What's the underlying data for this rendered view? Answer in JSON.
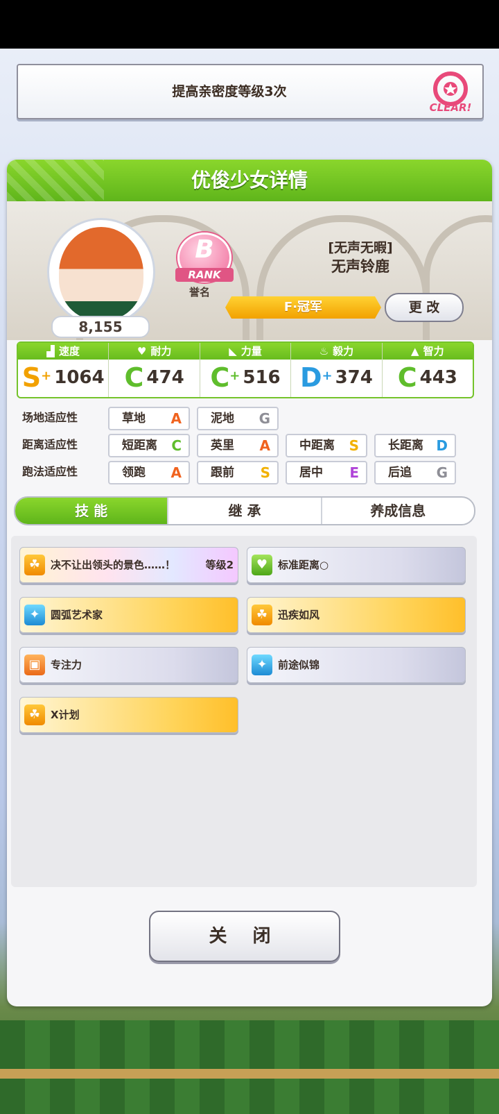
{
  "mission": {
    "text": "提高亲密度等级3次",
    "stamp": "CLEAR!"
  },
  "panel": {
    "title": "优俊少女详情",
    "fans": "8,155",
    "rank": {
      "letter": "B",
      "word": "RANK",
      "honor_label": "誉名"
    },
    "character": {
      "title": "[无声无暇]",
      "name": "无声铃鹿"
    },
    "epithet": "F·冠军",
    "change_button": "更 改"
  },
  "stats": [
    {
      "label": "速度",
      "icon": "shoe-icon",
      "grade": "S",
      "plus": "+",
      "value": "1064",
      "color": "#f2a100"
    },
    {
      "label": "耐力",
      "icon": "heart-icon",
      "grade": "C",
      "plus": "",
      "value": "474",
      "color": "#5fbd2c"
    },
    {
      "label": "力量",
      "icon": "muscle-icon",
      "grade": "C",
      "plus": "+",
      "value": "516",
      "color": "#5fbd2c"
    },
    {
      "label": "毅力",
      "icon": "flame-icon",
      "grade": "D",
      "plus": "+",
      "value": "374",
      "color": "#2a9be0"
    },
    {
      "label": "智力",
      "icon": "graduation-cap-icon",
      "grade": "C",
      "plus": "",
      "value": "443",
      "color": "#5fbd2c"
    }
  ],
  "aptitude": {
    "track": {
      "label": "场地适应性",
      "items": [
        {
          "name": "草地",
          "grade": "A"
        },
        {
          "name": "泥地",
          "grade": "G"
        }
      ]
    },
    "distance": {
      "label": "距离适应性",
      "items": [
        {
          "name": "短距离",
          "grade": "C"
        },
        {
          "name": "英里",
          "grade": "A"
        },
        {
          "name": "中距离",
          "grade": "S"
        },
        {
          "name": "长距离",
          "grade": "D"
        }
      ]
    },
    "style": {
      "label": "跑法适应性",
      "items": [
        {
          "name": "领跑",
          "grade": "A"
        },
        {
          "name": "跟前",
          "grade": "S"
        },
        {
          "name": "居中",
          "grade": "E"
        },
        {
          "name": "后追",
          "grade": "G"
        }
      ]
    }
  },
  "grade_colors": {
    "A": "#f0631f",
    "S": "#f2b100",
    "C": "#5fbd2c",
    "D": "#2a9be0",
    "E": "#b044d8",
    "G": "#8e8e96"
  },
  "tabs": [
    {
      "label": "技 能",
      "active": true
    },
    {
      "label": "继 承",
      "active": false
    },
    {
      "label": "养成信息",
      "active": false
    }
  ],
  "skills": [
    {
      "name": "决不让出领头的景色……！",
      "level": "等级2",
      "style": "rainbow",
      "icon": "runner-icon",
      "icon_color": "ic-gold"
    },
    {
      "name": "标准距离○",
      "level": "",
      "style": "silver",
      "icon": "heart-icon",
      "icon_color": "ic-green"
    },
    {
      "name": "圆弧艺术家",
      "level": "",
      "style": "gold",
      "icon": "sparkle-icon",
      "icon_color": "ic-blue"
    },
    {
      "name": "迅疾如风",
      "level": "",
      "style": "gold",
      "icon": "runner-icon",
      "icon_color": "ic-gold"
    },
    {
      "name": "专注力",
      "level": "",
      "style": "silver",
      "icon": "gate-icon",
      "icon_color": "ic-orange"
    },
    {
      "name": "前途似锦",
      "level": "",
      "style": "silver",
      "icon": "sparkle-icon",
      "icon_color": "ic-blue"
    },
    {
      "name": "X计划",
      "level": "",
      "style": "gold",
      "icon": "runner-icon",
      "icon_color": "ic-gold"
    }
  ],
  "close_button": "关 闭"
}
